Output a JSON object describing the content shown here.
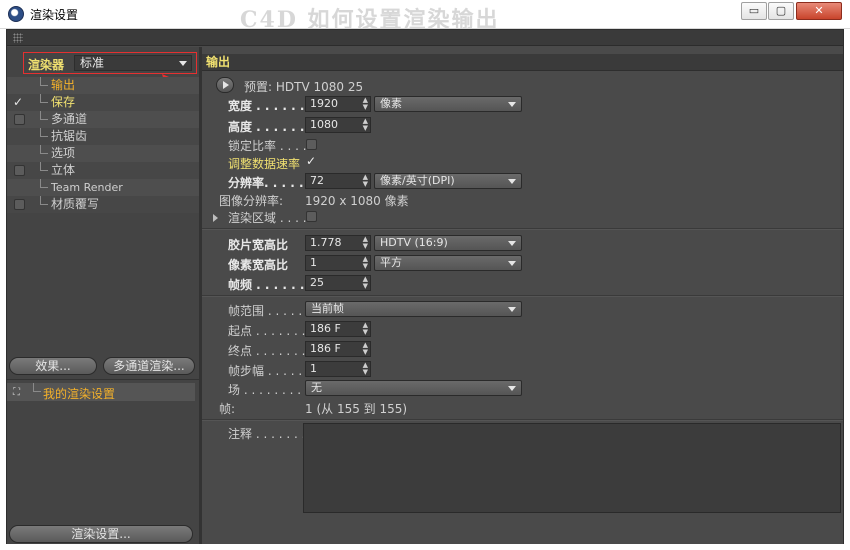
{
  "window": {
    "title": "渲染设置",
    "watermark": "C4D 如何设置渲染输出",
    "min_glyph": "▭",
    "max_glyph": "▢",
    "close_glyph": "✕"
  },
  "renderer": {
    "label": "渲染器",
    "value": "标准"
  },
  "tree": [
    {
      "label": "输出",
      "checkbox": "none",
      "state": "active"
    },
    {
      "label": "保存",
      "checkbox": "checked",
      "state": "save"
    },
    {
      "label": "多通道",
      "checkbox": "box",
      "state": ""
    },
    {
      "label": "抗锯齿",
      "checkbox": "none",
      "state": ""
    },
    {
      "label": "选项",
      "checkbox": "none",
      "state": ""
    },
    {
      "label": "立体",
      "checkbox": "box",
      "state": ""
    },
    {
      "label": "Team Render",
      "checkbox": "none",
      "state": "small"
    },
    {
      "label": "材质覆写",
      "checkbox": "box",
      "state": ""
    }
  ],
  "tree_tick": "✓",
  "buttons": {
    "effects": "效果...",
    "multipass": "多通道渲染...",
    "render_settings": "渲染设置..."
  },
  "presets": {
    "item": "我的渲染设置",
    "icon": "⛶"
  },
  "output": {
    "header": "输出",
    "preset_label": "预置: HDTV 1080 25",
    "width_label": "宽度 . . . . . . . . .",
    "width_value": "1920",
    "width_unit": "像素",
    "height_label": "高度 . . . . . . . . .",
    "height_value": "1080",
    "lock_ratio_label": "锁定比率 . . . .",
    "adjust_rate_label": "调整数据速率",
    "tick": "✓",
    "resolution_label": "分辨率. . . . . . .",
    "resolution_value": "72",
    "resolution_unit": "像素/英寸(DPI)",
    "image_res_label": "图像分辨率:",
    "image_res_value": "1920 x 1080 像素",
    "render_region_label": "渲染区域 . . . .",
    "film_aspect_label": "胶片宽高比",
    "film_aspect_value": "1.778",
    "film_aspect_preset": "HDTV (16:9)",
    "pixel_aspect_label": "像素宽高比",
    "pixel_aspect_value": "1",
    "pixel_aspect_preset": "平方",
    "fps_label": "帧频 . . . . . . . .",
    "fps_value": "25",
    "frame_range_label": "帧范围 . . . . . .",
    "frame_range_value": "当前帧",
    "start_label": "起点 . . . . . . . . .",
    "start_value": "186 F",
    "end_label": "终点 . . . . . . . . .",
    "end_value": "186 F",
    "step_label": "帧步幅 . . . . . . .",
    "step_value": "1",
    "field_label": "场 . . . . . . . . . . . .",
    "field_value": "无",
    "frames_label": "帧:",
    "frames_value": "1 (从 155 到 155)",
    "notes_label": "注释 . . . . . . . ."
  },
  "colors": {
    "accent_yellow": "#f0e070",
    "accent_orange": "#f4b12a",
    "highlight_red": "#e53030",
    "panel_bg": "#4a4a4a"
  }
}
